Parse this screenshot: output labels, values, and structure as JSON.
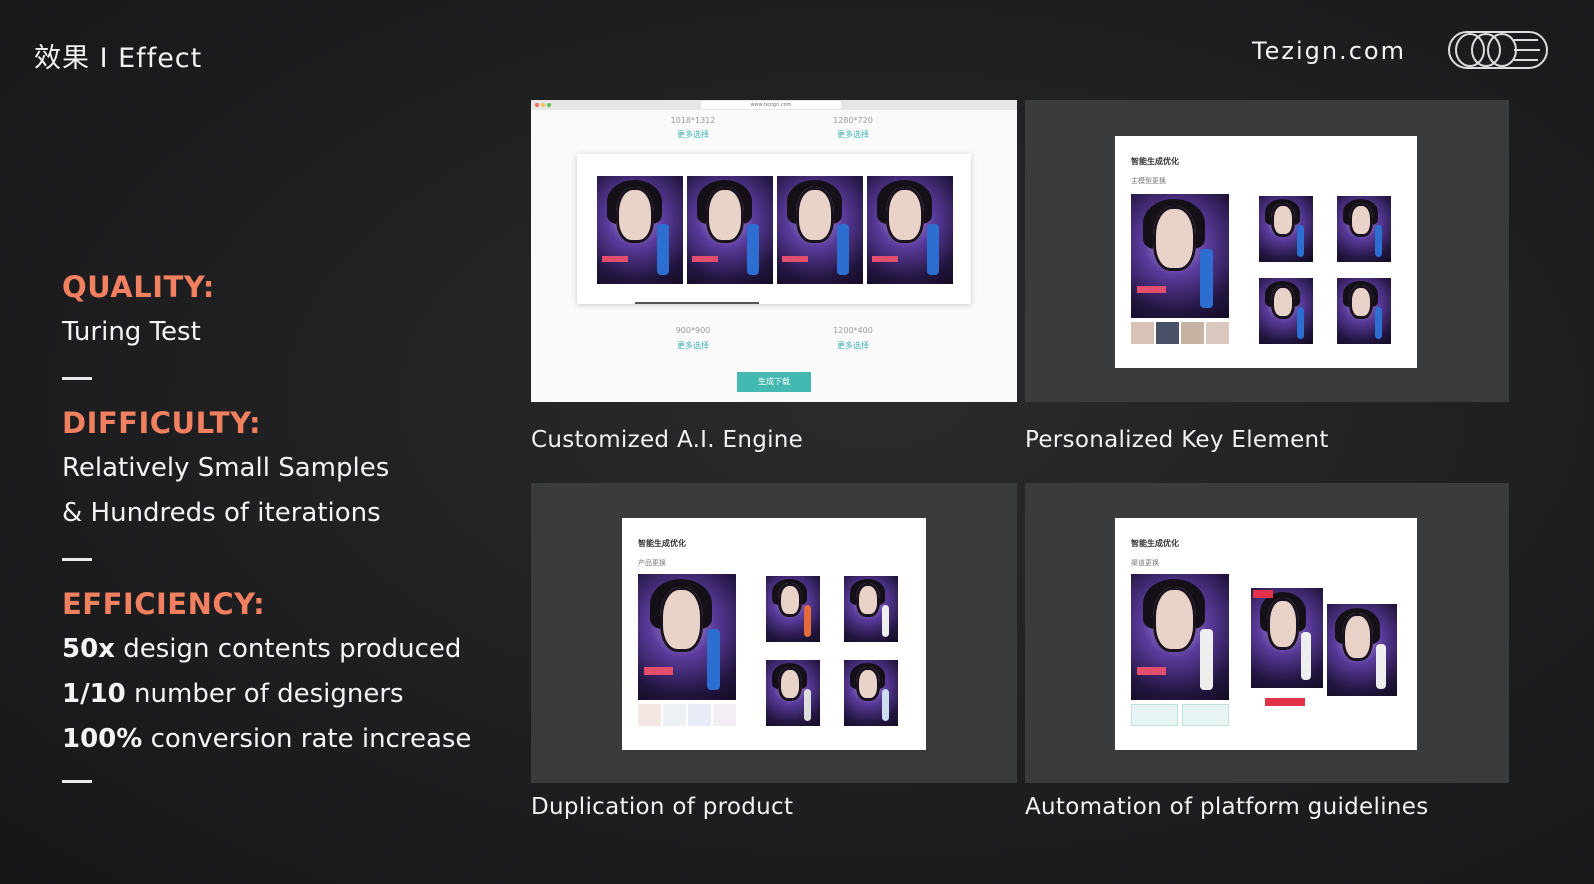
{
  "header": {
    "brand": "效果 I Effect",
    "site": "Tezign.com",
    "logo_icon": "tezign-logo-icon"
  },
  "metrics": {
    "quality_label": "QUALITY:",
    "quality_value": "Turing Test",
    "difficulty_label": "DIFFICULTY:",
    "difficulty_line1": "Relatively Small Samples",
    "difficulty_line2": "& Hundreds of iterations",
    "efficiency_label": "EFFICIENCY:",
    "eff1_num": "50x",
    "eff1_text": " design contents produced",
    "eff2_num": "1/10",
    "eff2_text": " number of designers",
    "eff3_num": "100%",
    "eff3_text": " conversion rate increase"
  },
  "panels": {
    "p1": {
      "caption": "Customized A.I. Engine",
      "url": "www.tezign.com",
      "size1": "1018*1312",
      "more1": "更多选择",
      "size2": "1280*720",
      "more2": "更多选择",
      "size3": "900*900",
      "more3": "更多选择",
      "size4": "1200*400",
      "more4": "更多选择",
      "button": "生成下载"
    },
    "p2": {
      "caption": "Personalized Key Element",
      "title": "智能生成优化",
      "subtitle": "主模型更换"
    },
    "p3": {
      "caption": "Duplication of product",
      "title": "智能生成优化",
      "subtitle": "产品更换"
    },
    "p4": {
      "caption": "Automation of platform guidelines",
      "title": "智能生成优化",
      "subtitle": "渠道更换"
    }
  },
  "colors": {
    "accent": "#f0805f",
    "teal": "#43b9b2",
    "background": "#1c1c1e"
  }
}
